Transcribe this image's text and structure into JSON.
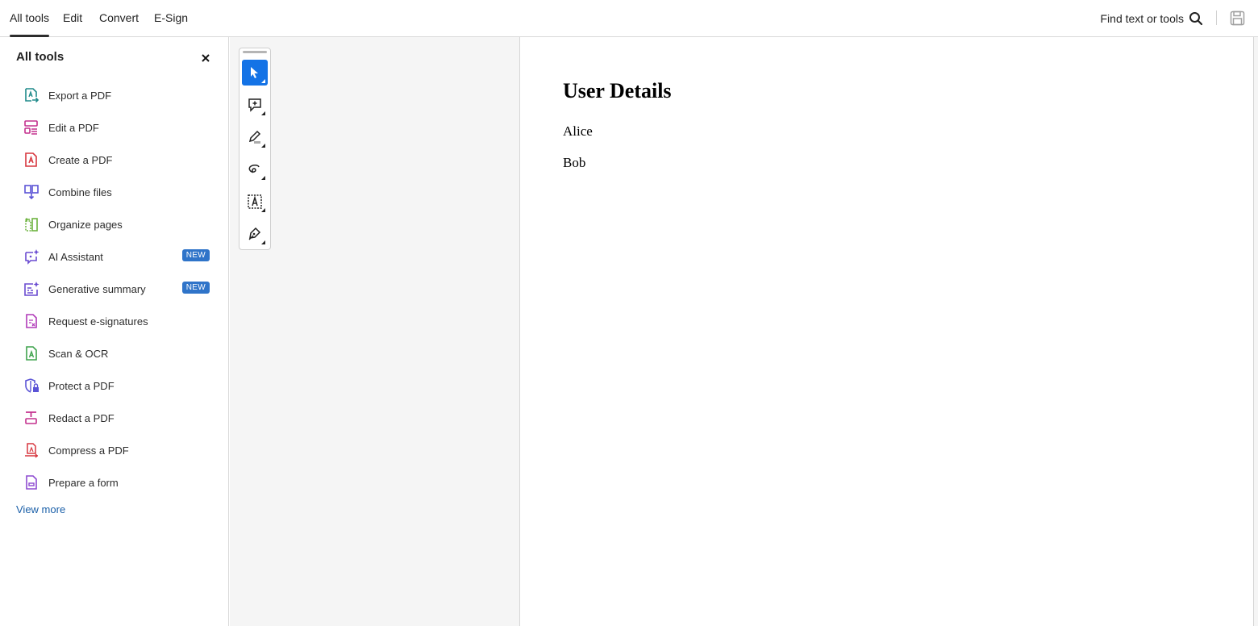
{
  "topbar": {
    "tabs": [
      {
        "label": "All tools",
        "active": true
      },
      {
        "label": "Edit",
        "active": false
      },
      {
        "label": "Convert",
        "active": false
      },
      {
        "label": "E-Sign",
        "active": false
      }
    ],
    "find_label": "Find text or tools",
    "search_icon": "search-icon",
    "save_icon": "save-icon"
  },
  "sidebar": {
    "title": "All tools",
    "close_icon": "close-icon",
    "items": [
      {
        "label": "Export a PDF",
        "icon": "export-pdf-icon",
        "color": "#1f8a8a"
      },
      {
        "label": "Edit a PDF",
        "icon": "edit-pdf-icon",
        "color": "#c4308e"
      },
      {
        "label": "Create a PDF",
        "icon": "create-pdf-icon",
        "color": "#d7373f"
      },
      {
        "label": "Combine files",
        "icon": "combine-files-icon",
        "color": "#5b54d6"
      },
      {
        "label": "Organize pages",
        "icon": "organize-pages-icon",
        "color": "#6db33f"
      },
      {
        "label": "AI Assistant",
        "icon": "ai-assistant-icon",
        "color": "#6a4bd1",
        "badge": "NEW"
      },
      {
        "label": "Generative summary",
        "icon": "generative-summary-icon",
        "color": "#6a4bd1",
        "badge": "NEW"
      },
      {
        "label": "Request e-signatures",
        "icon": "request-esignatures-icon",
        "color": "#b03ab8"
      },
      {
        "label": "Scan & OCR",
        "icon": "scan-ocr-icon",
        "color": "#3fa34d"
      },
      {
        "label": "Protect a PDF",
        "icon": "protect-pdf-icon",
        "color": "#5b54d6"
      },
      {
        "label": "Redact a PDF",
        "icon": "redact-pdf-icon",
        "color": "#c4308e"
      },
      {
        "label": "Compress a PDF",
        "icon": "compress-pdf-icon",
        "color": "#d7373f"
      },
      {
        "label": "Prepare a form",
        "icon": "prepare-form-icon",
        "color": "#8e4bd1"
      }
    ],
    "view_more": "View more"
  },
  "quick_toolbar": {
    "tools": [
      {
        "name": "select-tool",
        "active": true
      },
      {
        "name": "add-comment-tool",
        "active": false
      },
      {
        "name": "highlight-tool",
        "active": false
      },
      {
        "name": "draw-tool",
        "active": false
      },
      {
        "name": "text-tool",
        "active": false
      },
      {
        "name": "sign-tool",
        "active": false
      }
    ],
    "accent": "#1473e6"
  },
  "document": {
    "title": "User Details",
    "lines": [
      "Alice",
      "Bob"
    ]
  }
}
